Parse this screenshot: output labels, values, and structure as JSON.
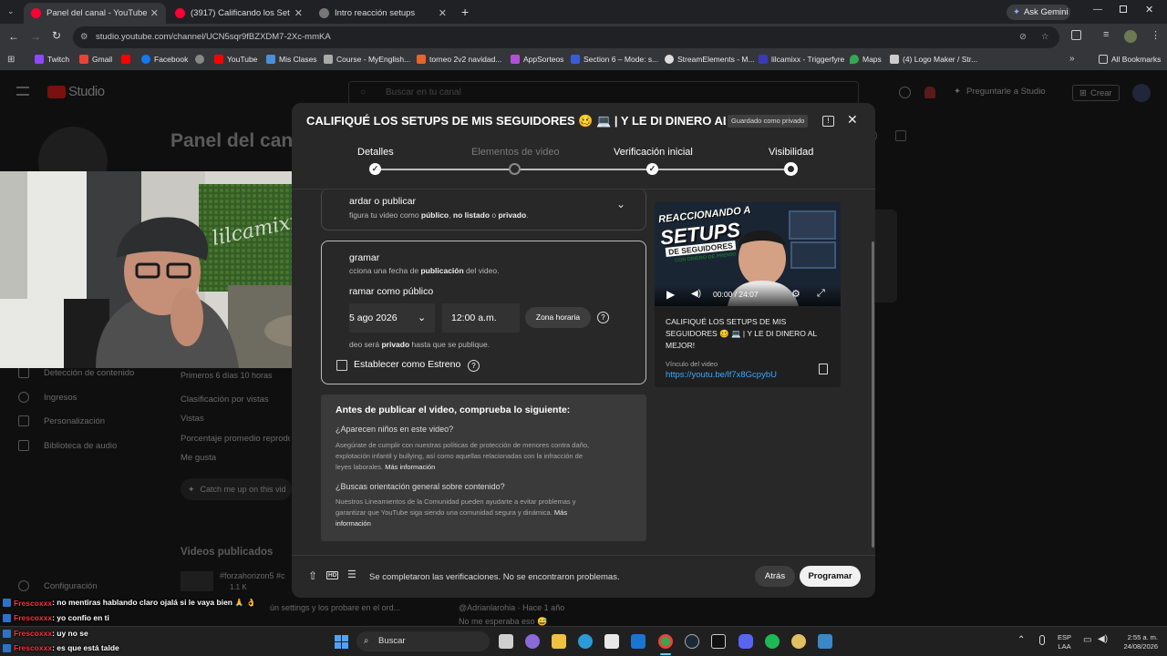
{
  "browser": {
    "tabs": [
      {
        "title": "Panel del canal - YouTube Studio",
        "active": true
      },
      {
        "title": "(3917) Calificando los Set Ups m",
        "active": false
      },
      {
        "title": "Intro reacción setups",
        "active": false
      }
    ],
    "new_tab_symbol": "+",
    "ask_gemini": "Ask Gemini",
    "url": "studio.youtube.com/channel/UCN5sqr9fBZXDM7-2Xc-mmKA",
    "bookmarks": [
      "Twitch",
      "Gmail",
      "Facebook",
      "YouTube",
      "Mis Clases",
      "Course - MyEnglish...",
      "torneo 2v2 navidad...",
      "AppSorteos",
      "Section 6 – Mode: s...",
      "StreamElements - M...",
      "lilcamixx - Triggerfyre",
      "Maps",
      "(4) Logo Maker / Str..."
    ],
    "all_bookmarks": "All Bookmarks"
  },
  "studio": {
    "logo": "Studio",
    "search_placeholder": "Buscar en tu canal",
    "ask_studio": "Preguntarle a Studio",
    "create": "Crear",
    "page_title": "Panel del canal",
    "sidebar": [
      "Detección de contenido",
      "Ingresos",
      "Personalización",
      "Biblioteca de audio"
    ],
    "sidebar_settings": "Configuración",
    "stats": [
      "Primeros 6 días 10 horas",
      "Clasificación por vistas",
      "Vistas",
      "Porcentaje promedio reproduci...",
      "Me gusta"
    ],
    "catch_up": "Catch me up on this vid",
    "published_heading": "Videos publicados",
    "published_tag": "#forzahorizon5 #c",
    "published_stats": "1.1 K",
    "comment_author": "@Adrianlarohia · Hace 1 año",
    "comment_text": "No me esperaba eso 😅",
    "bottom_snippet": "ún settings y los probare en el ord..."
  },
  "modal": {
    "title": "CALIFIQUÉ LOS SETUPS DE MIS SEGUIDORES 🥴 💻 | Y LE DI DINERO AL ...",
    "saved_badge": "Guardado como privado",
    "steps": [
      {
        "label": "Detalles",
        "state": "done"
      },
      {
        "label": "Elementos de video",
        "state": "disabled"
      },
      {
        "label": "Verificación inicial",
        "state": "done"
      },
      {
        "label": "Visibilidad",
        "state": "current"
      }
    ],
    "save_section": {
      "title": "ardar o publicar",
      "desc_prefix": "figura tu video como ",
      "desc_b1": "público",
      "desc_sep1": ", ",
      "desc_b2": "no listado",
      "desc_sep2": " o ",
      "desc_b3": "privado",
      "desc_suffix": "."
    },
    "schedule_section": {
      "title": "gramar",
      "desc_prefix": "cciona una fecha de ",
      "desc_b": "publicación",
      "desc_suffix": " del video.",
      "schedule_as": "ramar como público",
      "date": "5 ago 2026",
      "time": "12:00 a.m.",
      "timezone_button": "Zona horaria",
      "private_note_prefix": "deo será ",
      "private_note_b": "privado",
      "private_note_suffix": " hasta que se publique.",
      "premiere_label": "Establecer como Estreno"
    },
    "checklist": {
      "heading": "Antes de publicar el video, comprueba lo siguiente:",
      "q1": "¿Aparecen niños en este video?",
      "q1_text": "Asegúrate de cumplir con nuestras políticas de protección de menores contra daño, explotación infantil y bullying, así como aquellas relacionadas con la infracción de leyes laborales.",
      "q1_link": "Más información",
      "q2": "¿Buscas orientación general sobre contenido?",
      "q2_text": "Nuestros Lineamientos de la Comunidad pueden ayudarte a evitar problemas y garantizar que YouTube siga siendo una comunidad segura y dinámica.",
      "q2_link": "Más información"
    },
    "preview": {
      "thumb_line1": "REACCIONANDO A",
      "thumb_line2": "SETUPS",
      "thumb_line3": "DE SEGUIDORES",
      "thumb_line4": "CON DINERO DE PREMIO",
      "time": "00:00 / 24:07",
      "title": "CALIFIQUÉ LOS SETUPS DE MIS SEGUIDORES 🥴 💻 | Y LE DI DINERO AL MEJOR!",
      "link_label": "Vínculo del video",
      "link": "https://youtu.be/lf7x8GcpybU"
    },
    "footer": {
      "status": "Se completaron las verificaciones. No se encontraron problemas.",
      "back": "Atrás",
      "schedule": "Programar"
    }
  },
  "webcam": {
    "sign": "lilcamixx"
  },
  "chat": [
    {
      "user": "Frescoxxx",
      "msg": ": no mentiras hablando claro ojalá si le vaya bien 🙏 👌"
    },
    {
      "user": "Frescoxxx",
      "msg": ": yo confio en ti"
    },
    {
      "user": "Frescoxxx",
      "msg": ": uy no se"
    },
    {
      "user": "Frescoxxx",
      "msg": ": es que está talde"
    }
  ],
  "taskbar": {
    "search": "Buscar",
    "lang1": "ESP",
    "lang2": "LAA",
    "time": "2:55 a. m.",
    "date": "24/08/2026"
  }
}
